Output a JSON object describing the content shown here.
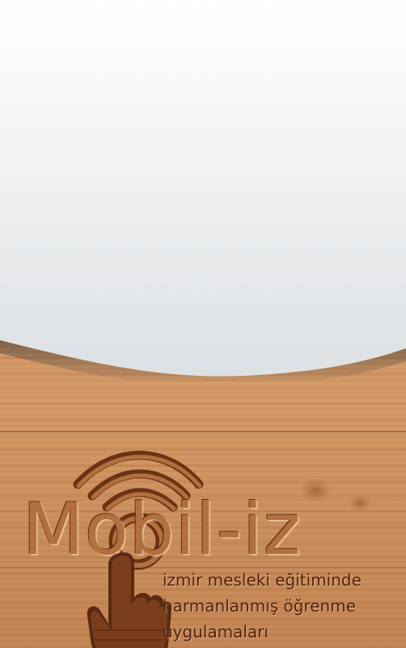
{
  "logo": {
    "title": "Mobil-iz",
    "tagline_line1": "izmir mesleki eğitiminde",
    "tagline_line2": "harmanlanmış öğrenme",
    "tagline_line3": "uygulamaları",
    "wifi_icon": "wifi-signal-icon",
    "hand_icon": "pointing-hand-icon"
  },
  "colors": {
    "panel_top": "#ffffff",
    "panel_bottom": "#dfe3e6",
    "wood": "#c98e5b",
    "engrave": "#4e2410"
  }
}
